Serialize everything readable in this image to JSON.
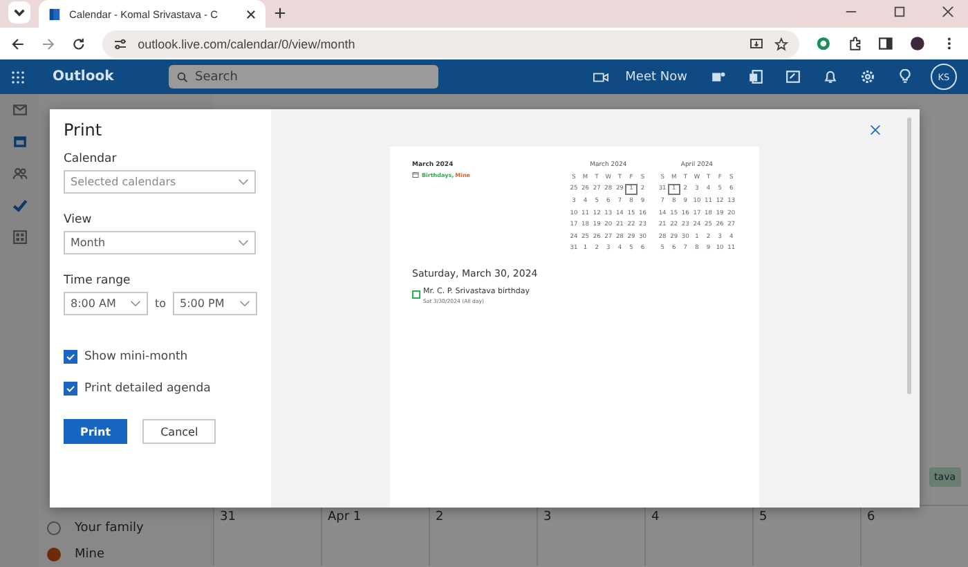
{
  "browser": {
    "tab_title": "Calendar - Komal Srivastava - C",
    "url": "outlook.live.com/calendar/0/view/month"
  },
  "app_bar": {
    "app_name": "Outlook",
    "search": {
      "placeholder": "Search"
    },
    "meet_now": "Meet Now",
    "avatar": "KS"
  },
  "background": {
    "calendars": [
      {
        "label": "Your family",
        "checked": false
      },
      {
        "label": "Mine",
        "checked": true
      }
    ],
    "dates": [
      "31",
      "Apr 1",
      "2",
      "3",
      "4",
      "5",
      "6"
    ],
    "event_chip": "tava"
  },
  "dialog": {
    "title": "Print",
    "calendar": {
      "label": "Calendar",
      "value": "Selected calendars"
    },
    "view": {
      "label": "View",
      "value": "Month"
    },
    "time_range": {
      "label": "Time range",
      "from": "8:00 AM",
      "separator": "to",
      "to": "5:00 PM"
    },
    "options": [
      {
        "label": "Show mini-month",
        "checked": true
      },
      {
        "label": "Print detailed agenda",
        "checked": true
      }
    ],
    "buttons": [
      {
        "label": "Print",
        "kind": "primary"
      },
      {
        "label": "Cancel",
        "kind": "secondary"
      }
    ],
    "preview": {
      "month_title": "March 2024",
      "legend": [
        {
          "label": "Birthdays,",
          "color": "#2eaa4e"
        },
        {
          "label": "Mine",
          "color": "#e0622a"
        }
      ],
      "mini_months": [
        {
          "title": "March 2024",
          "weekdays": [
            "S",
            "M",
            "T",
            "W",
            "T",
            "F",
            "S"
          ],
          "weeks": [
            [
              {
                "d": "25",
                "boxed": false
              },
              {
                "d": "26",
                "boxed": false
              },
              {
                "d": "27",
                "boxed": false
              },
              {
                "d": "28",
                "boxed": false
              },
              {
                "d": "29",
                "boxed": false
              },
              {
                "d": "1",
                "boxed": true
              },
              {
                "d": "2",
                "boxed": false
              }
            ],
            [
              {
                "d": "3",
                "boxed": false
              },
              {
                "d": "4",
                "boxed": false
              },
              {
                "d": "5",
                "boxed": false
              },
              {
                "d": "6",
                "boxed": false
              },
              {
                "d": "7",
                "boxed": false
              },
              {
                "d": "8",
                "boxed": false
              },
              {
                "d": "9",
                "boxed": false
              }
            ],
            [
              {
                "d": "10",
                "boxed": false
              },
              {
                "d": "11",
                "boxed": false
              },
              {
                "d": "12",
                "boxed": false
              },
              {
                "d": "13",
                "boxed": false
              },
              {
                "d": "14",
                "boxed": false
              },
              {
                "d": "15",
                "boxed": false
              },
              {
                "d": "16",
                "boxed": false
              }
            ],
            [
              {
                "d": "17",
                "boxed": false
              },
              {
                "d": "18",
                "boxed": false
              },
              {
                "d": "19",
                "boxed": false
              },
              {
                "d": "20",
                "boxed": false
              },
              {
                "d": "21",
                "boxed": false
              },
              {
                "d": "22",
                "boxed": false
              },
              {
                "d": "23",
                "boxed": false
              }
            ],
            [
              {
                "d": "24",
                "boxed": false
              },
              {
                "d": "25",
                "boxed": false
              },
              {
                "d": "26",
                "boxed": false
              },
              {
                "d": "27",
                "boxed": false
              },
              {
                "d": "28",
                "boxed": false
              },
              {
                "d": "29",
                "boxed": false
              },
              {
                "d": "30",
                "boxed": false
              }
            ],
            [
              {
                "d": "31",
                "boxed": false
              },
              {
                "d": "1",
                "boxed": false
              },
              {
                "d": "2",
                "boxed": false
              },
              {
                "d": "3",
                "boxed": false
              },
              {
                "d": "4",
                "boxed": false
              },
              {
                "d": "5",
                "boxed": false
              },
              {
                "d": "6",
                "boxed": false
              }
            ]
          ]
        },
        {
          "title": "April 2024",
          "weekdays": [
            "S",
            "M",
            "T",
            "W",
            "T",
            "F",
            "S"
          ],
          "weeks": [
            [
              {
                "d": "31",
                "boxed": false
              },
              {
                "d": "1",
                "boxed": true
              },
              {
                "d": "2",
                "boxed": false
              },
              {
                "d": "3",
                "boxed": false
              },
              {
                "d": "4",
                "boxed": false
              },
              {
                "d": "5",
                "boxed": false
              },
              {
                "d": "6",
                "boxed": false
              }
            ],
            [
              {
                "d": "7",
                "boxed": false
              },
              {
                "d": "8",
                "boxed": false
              },
              {
                "d": "9",
                "boxed": false
              },
              {
                "d": "10",
                "boxed": false
              },
              {
                "d": "11",
                "boxed": false
              },
              {
                "d": "12",
                "boxed": false
              },
              {
                "d": "13",
                "boxed": false
              }
            ],
            [
              {
                "d": "14",
                "boxed": false
              },
              {
                "d": "15",
                "boxed": false
              },
              {
                "d": "16",
                "boxed": false
              },
              {
                "d": "17",
                "boxed": false
              },
              {
                "d": "18",
                "boxed": false
              },
              {
                "d": "19",
                "boxed": false
              },
              {
                "d": "20",
                "boxed": false
              }
            ],
            [
              {
                "d": "21",
                "boxed": false
              },
              {
                "d": "22",
                "boxed": false
              },
              {
                "d": "23",
                "boxed": false
              },
              {
                "d": "24",
                "boxed": false
              },
              {
                "d": "25",
                "boxed": false
              },
              {
                "d": "26",
                "boxed": false
              },
              {
                "d": "27",
                "boxed": false
              }
            ],
            [
              {
                "d": "28",
                "boxed": false
              },
              {
                "d": "29",
                "boxed": false
              },
              {
                "d": "30",
                "boxed": false
              },
              {
                "d": "1",
                "boxed": false
              },
              {
                "d": "2",
                "boxed": false
              },
              {
                "d": "3",
                "boxed": false
              },
              {
                "d": "4",
                "boxed": false
              }
            ],
            [
              {
                "d": "5",
                "boxed": false
              },
              {
                "d": "6",
                "boxed": false
              },
              {
                "d": "7",
                "boxed": false
              },
              {
                "d": "8",
                "boxed": false
              },
              {
                "d": "9",
                "boxed": false
              },
              {
                "d": "10",
                "boxed": false
              },
              {
                "d": "11",
                "boxed": false
              }
            ]
          ]
        }
      ],
      "agenda_date": "Saturday, March 30, 2024",
      "events": [
        {
          "title": "Mr. C. P. Srivastava birthday",
          "subtitle": "Sat 3/30/2024 (All day)",
          "color": "#2eaa4e"
        }
      ]
    }
  }
}
